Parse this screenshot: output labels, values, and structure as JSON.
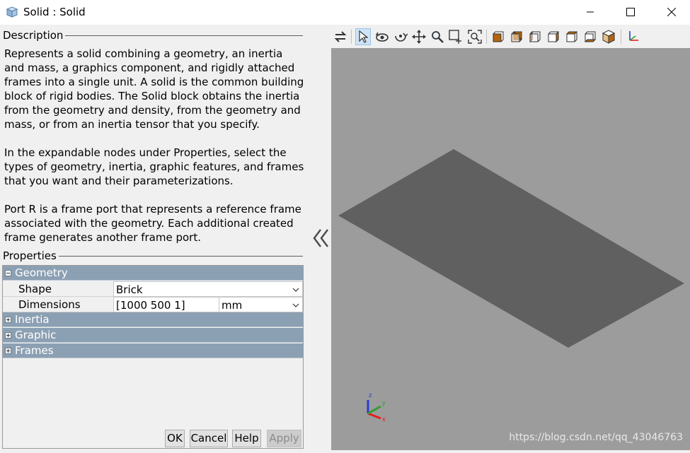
{
  "window": {
    "title": "Solid : Solid",
    "icons": {
      "app": "solid-block-icon",
      "minimize": "minimize-icon",
      "maximize": "maximize-icon",
      "close": "close-icon"
    }
  },
  "description": {
    "heading": "Description",
    "paragraphs": [
      "Represents a solid combining a geometry, an inertia and mass, a graphics component, and rigidly attached frames into a single unit. A solid is the common building block of rigid bodies. The Solid block obtains the inertia from the geometry and density, from the geometry and mass, or from an inertia tensor that you specify.",
      "In the expandable nodes under Properties, select the types of geometry, inertia, graphic features, and frames that you want and their parameterizations.",
      "Port R is a frame port that represents a reference frame associated with the geometry. Each additional created frame generates another frame port."
    ]
  },
  "properties": {
    "heading": "Properties",
    "geometry": {
      "label": "Geometry",
      "shape_label": "Shape",
      "shape_value": "Brick",
      "dimensions_label": "Dimensions",
      "dimensions_value": "[1000 500 1]",
      "dimensions_unit": "mm"
    },
    "inertia_label": "Inertia",
    "graphic_label": "Graphic",
    "frames_label": "Frames"
  },
  "buttons": {
    "ok": "OK",
    "cancel": "Cancel",
    "help": "Help",
    "apply": "Apply"
  },
  "toolbar": {
    "icons": [
      "swap-icon",
      "select-pointer-icon",
      "rotate-icon",
      "roll-icon",
      "pan-icon",
      "zoom-icon",
      "zoom-box-icon",
      "fit-to-view-icon",
      "front-view-icon",
      "back-view-icon",
      "left-view-icon",
      "right-view-icon",
      "top-view-icon",
      "bottom-view-icon",
      "isometric-view-icon",
      "triad-icon"
    ]
  },
  "viewport": {
    "axes": {
      "z": "z",
      "y": "y",
      "x": "x"
    },
    "watermark": "https://blog.csdn.net/qq_43046763",
    "colors": {
      "background": "#9c9c9c",
      "plate": "#606060",
      "x_axis": "#e02020",
      "y_axis": "#2e9e2e",
      "z_axis": "#2a3bd0"
    }
  }
}
